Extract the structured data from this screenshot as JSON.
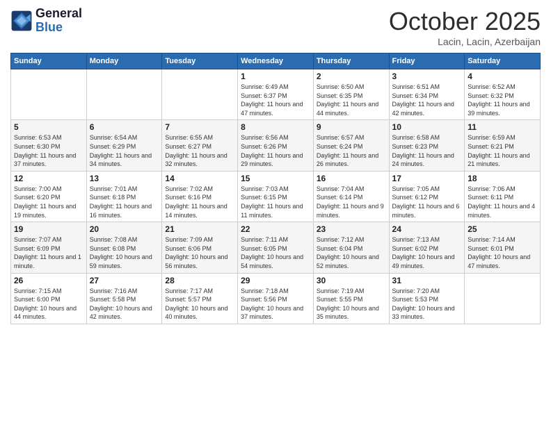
{
  "header": {
    "logo_line1": "General",
    "logo_line2": "Blue",
    "month": "October 2025",
    "location": "Lacin, Lacin, Azerbaijan"
  },
  "weekdays": [
    "Sunday",
    "Monday",
    "Tuesday",
    "Wednesday",
    "Thursday",
    "Friday",
    "Saturday"
  ],
  "weeks": [
    [
      {
        "day": "",
        "info": ""
      },
      {
        "day": "",
        "info": ""
      },
      {
        "day": "",
        "info": ""
      },
      {
        "day": "1",
        "info": "Sunrise: 6:49 AM\nSunset: 6:37 PM\nDaylight: 11 hours and 47 minutes."
      },
      {
        "day": "2",
        "info": "Sunrise: 6:50 AM\nSunset: 6:35 PM\nDaylight: 11 hours and 44 minutes."
      },
      {
        "day": "3",
        "info": "Sunrise: 6:51 AM\nSunset: 6:34 PM\nDaylight: 11 hours and 42 minutes."
      },
      {
        "day": "4",
        "info": "Sunrise: 6:52 AM\nSunset: 6:32 PM\nDaylight: 11 hours and 39 minutes."
      }
    ],
    [
      {
        "day": "5",
        "info": "Sunrise: 6:53 AM\nSunset: 6:30 PM\nDaylight: 11 hours and 37 minutes."
      },
      {
        "day": "6",
        "info": "Sunrise: 6:54 AM\nSunset: 6:29 PM\nDaylight: 11 hours and 34 minutes."
      },
      {
        "day": "7",
        "info": "Sunrise: 6:55 AM\nSunset: 6:27 PM\nDaylight: 11 hours and 32 minutes."
      },
      {
        "day": "8",
        "info": "Sunrise: 6:56 AM\nSunset: 6:26 PM\nDaylight: 11 hours and 29 minutes."
      },
      {
        "day": "9",
        "info": "Sunrise: 6:57 AM\nSunset: 6:24 PM\nDaylight: 11 hours and 26 minutes."
      },
      {
        "day": "10",
        "info": "Sunrise: 6:58 AM\nSunset: 6:23 PM\nDaylight: 11 hours and 24 minutes."
      },
      {
        "day": "11",
        "info": "Sunrise: 6:59 AM\nSunset: 6:21 PM\nDaylight: 11 hours and 21 minutes."
      }
    ],
    [
      {
        "day": "12",
        "info": "Sunrise: 7:00 AM\nSunset: 6:20 PM\nDaylight: 11 hours and 19 minutes."
      },
      {
        "day": "13",
        "info": "Sunrise: 7:01 AM\nSunset: 6:18 PM\nDaylight: 11 hours and 16 minutes."
      },
      {
        "day": "14",
        "info": "Sunrise: 7:02 AM\nSunset: 6:16 PM\nDaylight: 11 hours and 14 minutes."
      },
      {
        "day": "15",
        "info": "Sunrise: 7:03 AM\nSunset: 6:15 PM\nDaylight: 11 hours and 11 minutes."
      },
      {
        "day": "16",
        "info": "Sunrise: 7:04 AM\nSunset: 6:14 PM\nDaylight: 11 hours and 9 minutes."
      },
      {
        "day": "17",
        "info": "Sunrise: 7:05 AM\nSunset: 6:12 PM\nDaylight: 11 hours and 6 minutes."
      },
      {
        "day": "18",
        "info": "Sunrise: 7:06 AM\nSunset: 6:11 PM\nDaylight: 11 hours and 4 minutes."
      }
    ],
    [
      {
        "day": "19",
        "info": "Sunrise: 7:07 AM\nSunset: 6:09 PM\nDaylight: 11 hours and 1 minute."
      },
      {
        "day": "20",
        "info": "Sunrise: 7:08 AM\nSunset: 6:08 PM\nDaylight: 10 hours and 59 minutes."
      },
      {
        "day": "21",
        "info": "Sunrise: 7:09 AM\nSunset: 6:06 PM\nDaylight: 10 hours and 56 minutes."
      },
      {
        "day": "22",
        "info": "Sunrise: 7:11 AM\nSunset: 6:05 PM\nDaylight: 10 hours and 54 minutes."
      },
      {
        "day": "23",
        "info": "Sunrise: 7:12 AM\nSunset: 6:04 PM\nDaylight: 10 hours and 52 minutes."
      },
      {
        "day": "24",
        "info": "Sunrise: 7:13 AM\nSunset: 6:02 PM\nDaylight: 10 hours and 49 minutes."
      },
      {
        "day": "25",
        "info": "Sunrise: 7:14 AM\nSunset: 6:01 PM\nDaylight: 10 hours and 47 minutes."
      }
    ],
    [
      {
        "day": "26",
        "info": "Sunrise: 7:15 AM\nSunset: 6:00 PM\nDaylight: 10 hours and 44 minutes."
      },
      {
        "day": "27",
        "info": "Sunrise: 7:16 AM\nSunset: 5:58 PM\nDaylight: 10 hours and 42 minutes."
      },
      {
        "day": "28",
        "info": "Sunrise: 7:17 AM\nSunset: 5:57 PM\nDaylight: 10 hours and 40 minutes."
      },
      {
        "day": "29",
        "info": "Sunrise: 7:18 AM\nSunset: 5:56 PM\nDaylight: 10 hours and 37 minutes."
      },
      {
        "day": "30",
        "info": "Sunrise: 7:19 AM\nSunset: 5:55 PM\nDaylight: 10 hours and 35 minutes."
      },
      {
        "day": "31",
        "info": "Sunrise: 7:20 AM\nSunset: 5:53 PM\nDaylight: 10 hours and 33 minutes."
      },
      {
        "day": "",
        "info": ""
      }
    ]
  ]
}
